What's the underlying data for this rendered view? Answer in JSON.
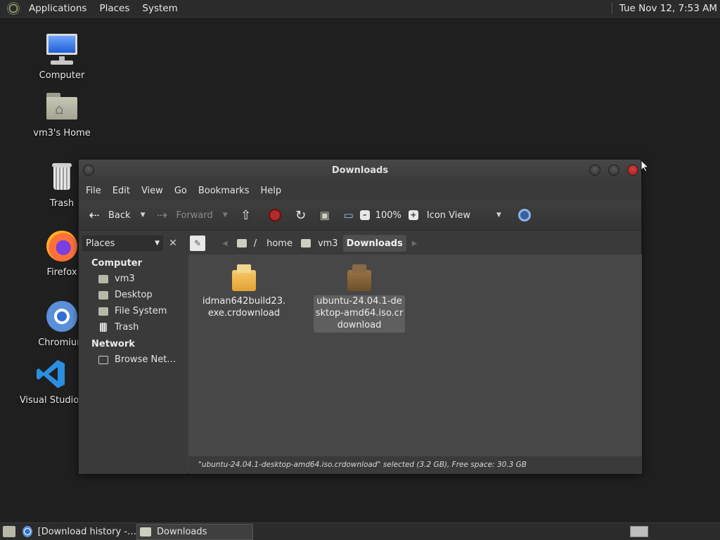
{
  "top_panel": {
    "menus": [
      "Applications",
      "Places",
      "System"
    ],
    "clock": "Tue Nov 12,  7:53 AM"
  },
  "desktop_icons": {
    "computer": "Computer",
    "home": "vm3's Home",
    "trash": "Trash",
    "firefox": "Firefox",
    "chromium": "Chromium",
    "vscode": "Visual Studio"
  },
  "window": {
    "title": "Downloads",
    "menubar": [
      "File",
      "Edit",
      "View",
      "Go",
      "Bookmarks",
      "Help"
    ],
    "toolbar": {
      "back": "Back",
      "forward": "Forward",
      "zoom": "100%",
      "view_mode": "Icon View"
    },
    "location": {
      "sidebar_mode": "Places",
      "crumbs": [
        "/",
        "home",
        "vm3",
        "Downloads"
      ]
    },
    "sidebar": {
      "computer_heading": "Computer",
      "computer_items": [
        "vm3",
        "Desktop",
        "File System",
        "Trash"
      ],
      "network_heading": "Network",
      "network_items": [
        "Browse Net…"
      ]
    },
    "files": [
      {
        "name": "idman642build23.exe.crdownload",
        "selected": false
      },
      {
        "name": "ubuntu-24.04.1-desktop-amd64.iso.crdownload",
        "selected": true
      }
    ],
    "status": "\"ubuntu-24.04.1-desktop-amd64.iso.crdownload\" selected (3.2 GB), Free space: 30.3 GB"
  },
  "taskbar": {
    "tasks": [
      "[Download history -…",
      "Downloads"
    ]
  }
}
